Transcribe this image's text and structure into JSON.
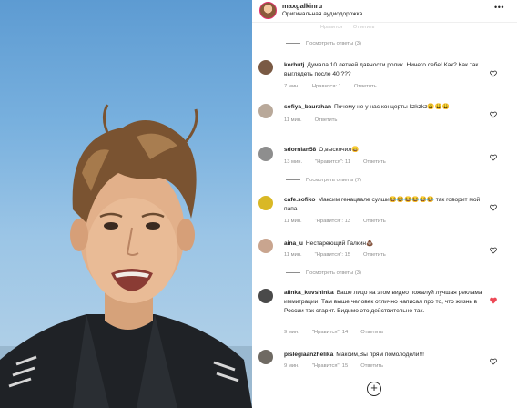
{
  "header": {
    "username": "maxgalkinru",
    "subtitle": "Оригинальная аудиодорожка",
    "more_icon": "ellipsis-icon"
  },
  "faded_row": {
    "time": "",
    "like": "Нравится",
    "reply": "Ответить"
  },
  "view_replies_label": "Посмотреть ответы",
  "comments": [
    {
      "username": "korbutj",
      "text": "Думала 10 летней давности ролик. Ничего себе! Как? Как так выглядеть после 40!???",
      "time": "7 мин.",
      "likes": "Нравится: 1",
      "reply": "Ответить",
      "avatar_color": "#7a5a44",
      "liked": false
    },
    {
      "username": "sofiya_baurzhan",
      "text": "Почему не у нас концерты kzkzkz😩😩😩",
      "time": "11 мин.",
      "likes": "",
      "reply": "Ответить",
      "avatar_color": "#b9a99a",
      "liked": false
    },
    {
      "username": "sdornian58",
      "text": "О,выскочил😄",
      "time": "13 мин.",
      "likes": "\"Нравится\": 11",
      "reply": "Ответить",
      "avatar_color": "#8e8e8e",
      "liked": false
    },
    {
      "username": "cafe.sofiko",
      "text": "Максим генацвале сулши😂😂😂😂😂😂 так говорит мой папа",
      "time": "11 мин.",
      "likes": "\"Нравится\": 13",
      "reply": "Ответить",
      "avatar_color": "#d9b825",
      "liked": false
    },
    {
      "username": "aina_u",
      "text": "Нестареющий Галкин💩",
      "time": "11 мин.",
      "likes": "\"Нравится\": 15",
      "reply": "Ответить",
      "avatar_color": "#c9a58f",
      "liked": false
    },
    {
      "username": "alinka_kuvshinka",
      "text": "Ваше лицо на этом видео пожалуй лучшая реклама иммиграции. Там выше человек отлично написал про то, что жизнь в России так старит. Видимо это действительно так.",
      "time": "9 мин.",
      "likes": "\"Нравится\": 14",
      "reply": "Ответить",
      "avatar_color": "#4a4a4a",
      "liked": true
    },
    {
      "username": "pislegiaanzhelika",
      "text": "Максим,Вы прям помолодели!!!",
      "time": "9 мин.",
      "likes": "\"Нравится\": 15",
      "reply": "Ответить",
      "avatar_color": "#6f6a63",
      "liked": false
    }
  ],
  "reply_counts": [
    "(3)",
    "(7)",
    "(3)"
  ],
  "colors": {
    "heart_liked": "#ed4956",
    "meta": "#8e8e8e",
    "text": "#262626"
  },
  "load_more_icon": "plus-circle-icon"
}
